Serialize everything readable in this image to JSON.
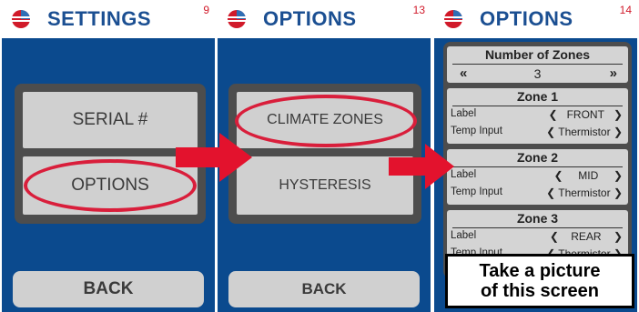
{
  "screens": [
    {
      "title": "SETTINGS",
      "number": "9",
      "buttons": [
        "SERIAL #",
        "OPTIONS"
      ],
      "back": "BACK"
    },
    {
      "title": "OPTIONS",
      "number": "13",
      "buttons": [
        "CLIMATE ZONES",
        "HYSTERESIS"
      ],
      "back": "BACK"
    },
    {
      "title": "OPTIONS",
      "number": "14",
      "zones_count": {
        "title": "Number of Zones",
        "prev": "«",
        "value": "3",
        "next": "»"
      },
      "zones": [
        {
          "title": "Zone 1",
          "label_caption": "Label",
          "label_value": "FRONT",
          "temp_caption": "Temp Input",
          "temp_value": "Thermistor"
        },
        {
          "title": "Zone 2",
          "label_caption": "Label",
          "label_value": "MID",
          "temp_caption": "Temp Input",
          "temp_value": "Thermistor"
        },
        {
          "title": "Zone 3",
          "label_caption": "Label",
          "label_value": "REAR",
          "temp_caption": "Temp Input",
          "temp_value": "Thermistor"
        }
      ]
    }
  ],
  "callout": [
    "Take a picture",
    "of this screen"
  ],
  "colors": {
    "screen_bg": "#0b4a8e",
    "button_bg": "#d0d0d0",
    "highlight": "#d91e3b",
    "title": "#1b4f92"
  }
}
